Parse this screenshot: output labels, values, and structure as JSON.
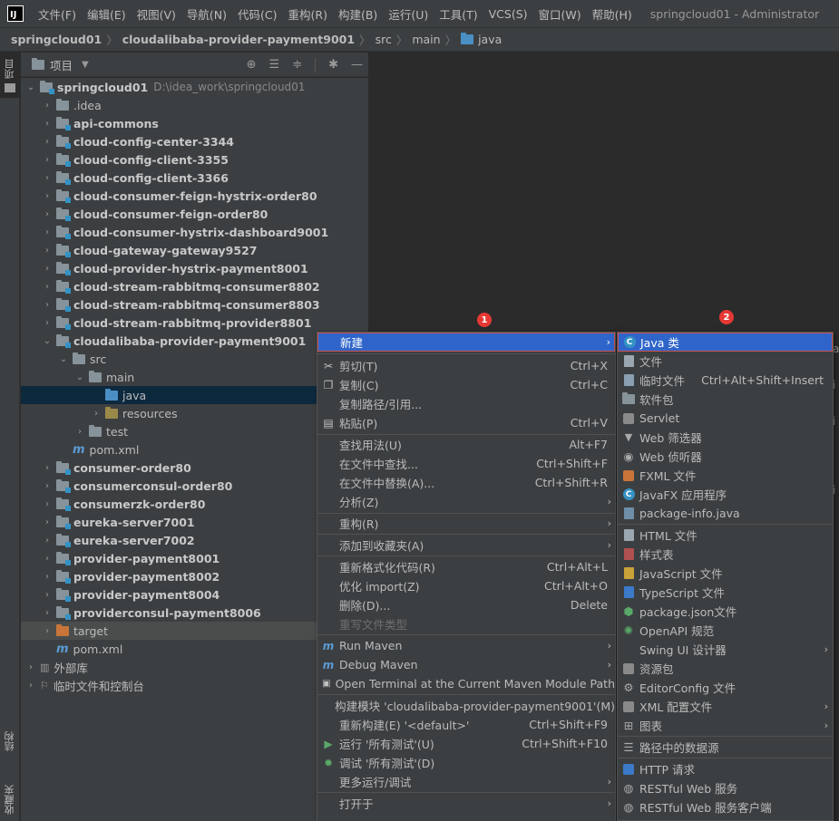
{
  "menubar": {
    "logo": "IJ",
    "items": [
      "文件(F)",
      "编辑(E)",
      "视图(V)",
      "导航(N)",
      "代码(C)",
      "重构(R)",
      "构建(B)",
      "运行(U)",
      "工具(T)",
      "VCS(S)",
      "窗口(W)",
      "帮助(H)"
    ],
    "window_title": "springcloud01 - Administrator"
  },
  "navbar": {
    "crumbs": [
      "springcloud01",
      "cloudalibaba-provider-payment9001",
      "src",
      "main",
      "java"
    ]
  },
  "left_strip": {
    "project_tab": "项目",
    "structure_tab": "结构",
    "favorites_tab": "收藏夹"
  },
  "project_panel": {
    "title": "项目"
  },
  "tree": {
    "root": {
      "name": "springcloud01",
      "path": "D:\\idea_work\\springcloud01"
    },
    "modules_top": [
      ".idea",
      "api-commons",
      "cloud-config-center-3344",
      "cloud-config-client-3355",
      "cloud-config-client-3366",
      "cloud-consumer-feign-hystrix-order80",
      "cloud-consumer-feign-order80",
      "cloud-consumer-hystrix-dashboard9001",
      "cloud-gateway-gateway9527",
      "cloud-provider-hystrix-payment8001",
      "cloud-stream-rabbitmq-consumer8802",
      "cloud-stream-rabbitmq-consumer8803",
      "cloud-stream-rabbitmq-provider8801"
    ],
    "expanded_module": "cloudalibaba-provider-payment9001",
    "src": "src",
    "main": "main",
    "java": "java",
    "resources": "resources",
    "test": "test",
    "module_pom": "pom.xml",
    "modules_bottom": [
      "consumer-order80",
      "consumerconsul-order80",
      "consumerzk-order80",
      "eureka-server7001",
      "eureka-server7002",
      "provider-payment8001",
      "provider-payment8002",
      "provider-payment8004",
      "providerconsul-payment8006"
    ],
    "target": "target",
    "root_pom": "pom.xml",
    "external_libs": "外部库",
    "scratches": "临时文件和控制台"
  },
  "context_menu": {
    "items": [
      {
        "label": "新建",
        "shortcut": "",
        "submenu": true,
        "icon": ""
      },
      {
        "label": "剪切(T)",
        "shortcut": "Ctrl+X",
        "icon": "scissors-icon"
      },
      {
        "label": "复制(C)",
        "shortcut": "Ctrl+C",
        "icon": "copy-icon"
      },
      {
        "label": "复制路径/引用...",
        "shortcut": "",
        "icon": ""
      },
      {
        "label": "粘贴(P)",
        "shortcut": "Ctrl+V",
        "icon": "paste-icon"
      },
      {
        "label": "查找用法(U)",
        "shortcut": "Alt+F7",
        "icon": ""
      },
      {
        "label": "在文件中查找...",
        "shortcut": "Ctrl+Shift+F",
        "icon": ""
      },
      {
        "label": "在文件中替换(A)...",
        "shortcut": "Ctrl+Shift+R",
        "icon": ""
      },
      {
        "label": "分析(Z)",
        "shortcut": "",
        "submenu": true,
        "icon": ""
      },
      {
        "label": "重构(R)",
        "shortcut": "",
        "submenu": true,
        "icon": ""
      },
      {
        "label": "添加到收藏夹(A)",
        "shortcut": "",
        "submenu": true,
        "icon": ""
      },
      {
        "label": "重新格式化代码(R)",
        "shortcut": "Ctrl+Alt+L",
        "icon": ""
      },
      {
        "label": "优化 import(Z)",
        "shortcut": "Ctrl+Alt+O",
        "icon": ""
      },
      {
        "label": "删除(D)...",
        "shortcut": "Delete",
        "icon": ""
      },
      {
        "label": "重写文件类型",
        "shortcut": "",
        "icon": "",
        "disabled": true
      },
      {
        "label": "Run Maven",
        "shortcut": "",
        "submenu": true,
        "icon": "maven-icon"
      },
      {
        "label": "Debug Maven",
        "shortcut": "",
        "submenu": true,
        "icon": "maven-icon"
      },
      {
        "label": "Open Terminal at the Current Maven Module Path",
        "shortcut": "",
        "icon": "terminal-icon"
      },
      {
        "label": "构建模块 'cloudalibaba-provider-payment9001'(M)",
        "shortcut": "",
        "icon": ""
      },
      {
        "label": "重新构建(E) '<default>'",
        "shortcut": "Ctrl+Shift+F9",
        "icon": ""
      },
      {
        "label": "运行 '所有测试'(U)",
        "shortcut": "Ctrl+Shift+F10",
        "icon": "run-icon"
      },
      {
        "label": "调试 '所有测试'(D)",
        "shortcut": "",
        "icon": "debug-icon"
      },
      {
        "label": "更多运行/调试",
        "shortcut": "",
        "submenu": true,
        "icon": ""
      },
      {
        "label": "打开于",
        "shortcut": "",
        "submenu": true,
        "icon": ""
      }
    ]
  },
  "submenu": {
    "items": [
      {
        "label": "Java 类",
        "shortcut": "",
        "icon": "java-class-icon"
      },
      {
        "label": "文件",
        "shortcut": "",
        "icon": "file-icon"
      },
      {
        "label": "临时文件",
        "shortcut": "Ctrl+Alt+Shift+Insert",
        "icon": "scratch-file-icon"
      },
      {
        "label": "软件包",
        "shortcut": "",
        "icon": "package-icon"
      },
      {
        "label": "Servlet",
        "shortcut": "",
        "icon": "servlet-icon"
      },
      {
        "label": "Web 筛选器",
        "shortcut": "",
        "icon": "filter-icon"
      },
      {
        "label": "Web 侦听器",
        "shortcut": "",
        "icon": "listener-icon"
      },
      {
        "label": "FXML 文件",
        "shortcut": "",
        "icon": "fxml-icon"
      },
      {
        "label": "JavaFX 应用程序",
        "shortcut": "",
        "icon": "javafx-icon"
      },
      {
        "label": "package-info.java",
        "shortcut": "",
        "icon": "package-info-icon"
      },
      {
        "label": "HTML 文件",
        "shortcut": "",
        "icon": "html-icon"
      },
      {
        "label": "样式表",
        "shortcut": "",
        "icon": "css-icon"
      },
      {
        "label": "JavaScript 文件",
        "shortcut": "",
        "icon": "javascript-icon"
      },
      {
        "label": "TypeScript 文件",
        "shortcut": "",
        "icon": "typescript-icon"
      },
      {
        "label": "package.json文件",
        "shortcut": "",
        "icon": "nodejs-icon"
      },
      {
        "label": "OpenAPI 规范",
        "shortcut": "",
        "icon": "openapi-icon"
      },
      {
        "label": "Swing UI 设计器",
        "shortcut": "",
        "submenu": true,
        "icon": ""
      },
      {
        "label": "资源包",
        "shortcut": "",
        "icon": "resource-bundle-icon"
      },
      {
        "label": "EditorConfig 文件",
        "shortcut": "",
        "icon": "editorconfig-icon"
      },
      {
        "label": "XML 配置文件",
        "shortcut": "",
        "submenu": true,
        "icon": "xml-icon"
      },
      {
        "label": "图表",
        "shortcut": "",
        "submenu": true,
        "icon": "diagram-icon"
      },
      {
        "label": "路径中的数据源",
        "shortcut": "",
        "icon": "datasource-icon"
      },
      {
        "label": "HTTP 请求",
        "shortcut": "",
        "icon": "http-request-icon"
      },
      {
        "label": "RESTful Web 服务",
        "shortcut": "",
        "icon": "restful-service-icon"
      },
      {
        "label": "RESTful Web 服务客户端",
        "shortcut": "",
        "icon": "restful-client-icon"
      }
    ]
  },
  "badges": [
    "1",
    "2"
  ],
  "colors": {
    "selection": "#2f65ca",
    "annotation_red": "#e53935",
    "folder_blue": "#4a8fc4"
  }
}
